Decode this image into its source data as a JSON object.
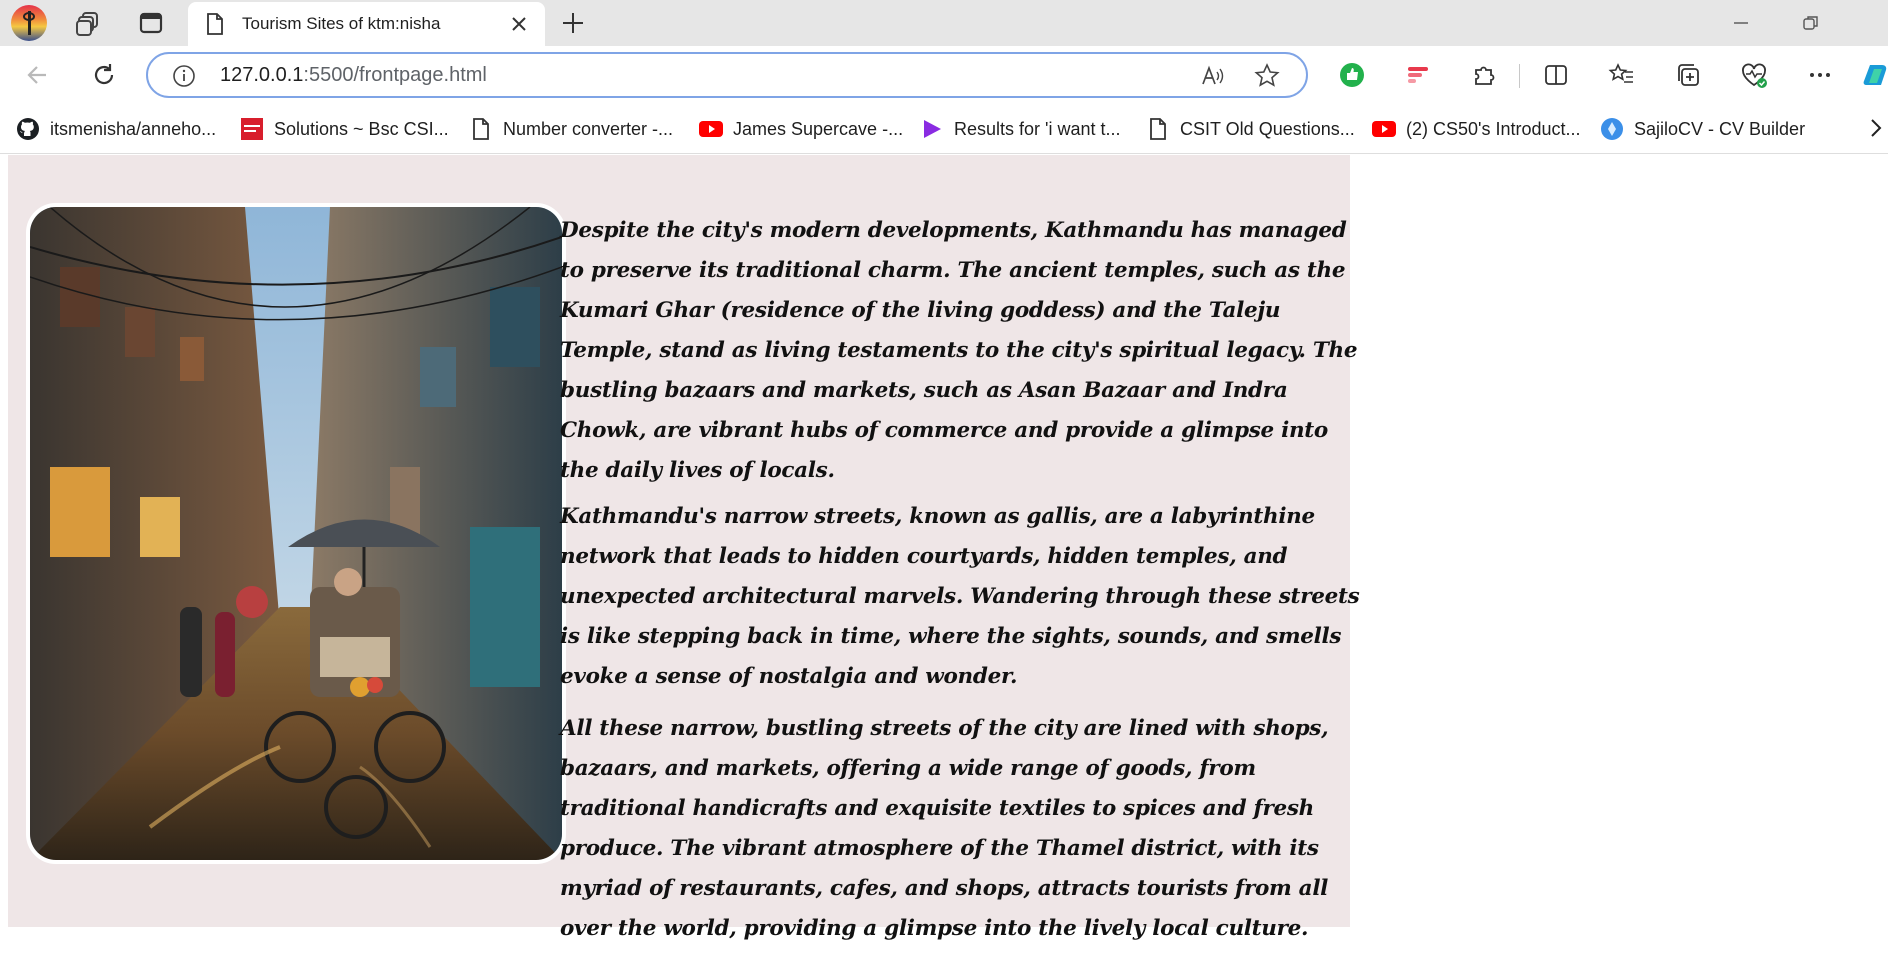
{
  "browser": {
    "tab": {
      "title": "Tourism Sites of ktm:nisha"
    },
    "address": {
      "host": "127.0.0.1",
      "path": ":5500/frontpage.html"
    },
    "bookmarks": [
      {
        "label": "itsmenisha/anneho...",
        "icon": "github-icon"
      },
      {
        "label": "Solutions ~ Bsc CSI...",
        "icon": "bsc-csit-icon"
      },
      {
        "label": "Number converter -...",
        "icon": "page-icon"
      },
      {
        "label": "James Supercave -...",
        "icon": "youtube-icon"
      },
      {
        "label": "Results for 'i want t...",
        "icon": "play-icon"
      },
      {
        "label": "CSIT Old Questions...",
        "icon": "page-icon"
      },
      {
        "label": "(2) CS50's Introduct...",
        "icon": "youtube-icon"
      },
      {
        "label": "SajiloCV - CV Builder",
        "icon": "sajilocv-icon"
      }
    ],
    "colors": {
      "tabstrip": "#e6e6e6",
      "omnibox_border": "#7fa4e6",
      "page_bg": "#efe6e7"
    }
  },
  "page": {
    "image_alt_subject": "street-photo",
    "paragraphs": [
      "Despite the city's modern developments, Kathmandu has managed to preserve its traditional charm. The ancient temples, such as the Kumari Ghar (residence of the living goddess) and the Taleju Temple, stand as living testaments to the city's spiritual legacy. The bustling bazaars and markets, such as Asan Bazaar and Indra Chowk, are vibrant hubs of commerce and provide a glimpse into the daily lives of locals.",
      "Kathmandu's narrow streets, known as gallis, are a labyrinthine network that leads to hidden courtyards, hidden temples, and unexpected architectural marvels. Wandering through these streets is like stepping back in time, where the sights, sounds, and smells evoke a sense of nostalgia and wonder.",
      "All these narrow, bustling streets of the city are lined with shops, bazaars, and markets, offering a wide range of goods, from traditional handicrafts and exquisite textiles to spices and fresh produce. The vibrant atmosphere of the Thamel district, with its myriad of restaurants, cafes, and shops, attracts tourists from all over the world, providing a glimpse into the lively local culture."
    ]
  }
}
